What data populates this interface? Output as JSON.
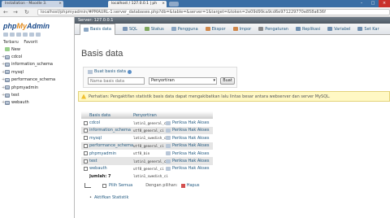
{
  "browser": {
    "tab_inactive": "Installation - Moodle 3.",
    "tab_active": "localhost / 127.0.0.1 | ph",
    "url": "localhost/phpmyadmin/#PMAURL-1:server_databases.php?db=&table=&server=1&target=&token=2e09d99ca9cd6e971229770e858a636f"
  },
  "left_panel": {
    "logo_php": "php",
    "logo_my": "My",
    "logo_admin": "Admin",
    "tab_recent": "Terbaru",
    "tab_favorites": "Favorit",
    "items": [
      "New",
      "cdcol",
      "information_schema",
      "mysql",
      "performance_schema",
      "phpmyadmin",
      "test",
      "webauth"
    ]
  },
  "server_bar": "Server: 127.0.0.1",
  "topnav": [
    {
      "label": "Basis data",
      "icon": "database-icon",
      "color": "#8aa6c4"
    },
    {
      "label": "SQL",
      "icon": "sql-icon",
      "color": "#7c97b8"
    },
    {
      "label": "Status",
      "icon": "status-icon",
      "color": "#7fa85f"
    },
    {
      "label": "Pengguna",
      "icon": "users-icon",
      "color": "#8aa6c4"
    },
    {
      "label": "Ekspor",
      "icon": "export-icon",
      "color": "#d0874a"
    },
    {
      "label": "Impor",
      "icon": "import-icon",
      "color": "#d0874a"
    },
    {
      "label": "Pengaturan",
      "icon": "settings-icon",
      "color": "#888888"
    },
    {
      "label": "Replikasi",
      "icon": "replication-icon",
      "color": "#6f8fb0"
    },
    {
      "label": "Variabel",
      "icon": "variables-icon",
      "color": "#6f8fb0"
    },
    {
      "label": "Set Kar",
      "icon": "charset-icon",
      "color": "#6f8fb0"
    }
  ],
  "page_title": "Basis data",
  "create_db": {
    "label": "Buat basis data",
    "name_placeholder": "Nama basis data",
    "collation_value": "Penyortiran",
    "button": "Buat"
  },
  "notice": "Perhatian: Pengaktifan statistik basis data dapat mengakibatkan lalu lintas besar antara webserver dan server MySQL.",
  "table": {
    "headers": {
      "name": "Basis data",
      "collation": "Penyortiran"
    },
    "rows": [
      {
        "name": "cdcol",
        "collation": "latin1_general_ci",
        "action": "Periksa Hak Akses"
      },
      {
        "name": "information_schema",
        "collation": "utf8_general_ci",
        "action": "Periksa Hak Akses"
      },
      {
        "name": "mysql",
        "collation": "latin1_swedish_ci",
        "action": "Periksa Hak Akses"
      },
      {
        "name": "performance_schema",
        "collation": "utf8_general_ci",
        "action": "Periksa Hak Akses"
      },
      {
        "name": "phpmyadmin",
        "collation": "utf8_bin",
        "action": "Periksa Hak Akses"
      },
      {
        "name": "test",
        "collation": "latin1_general_ci",
        "action": "Periksa Hak Akses"
      },
      {
        "name": "webauth",
        "collation": "utf8_general_ci",
        "action": "Periksa Hak Akses"
      }
    ],
    "total_label": "Jumlah: 7",
    "total_collation": "latin1_swedish_ci"
  },
  "footer": {
    "select_all": "Pilih Semua",
    "with_selected": "Dengan pilihan:",
    "drop": "Hapus"
  },
  "stats_link": "Aktifkan Statistik"
}
